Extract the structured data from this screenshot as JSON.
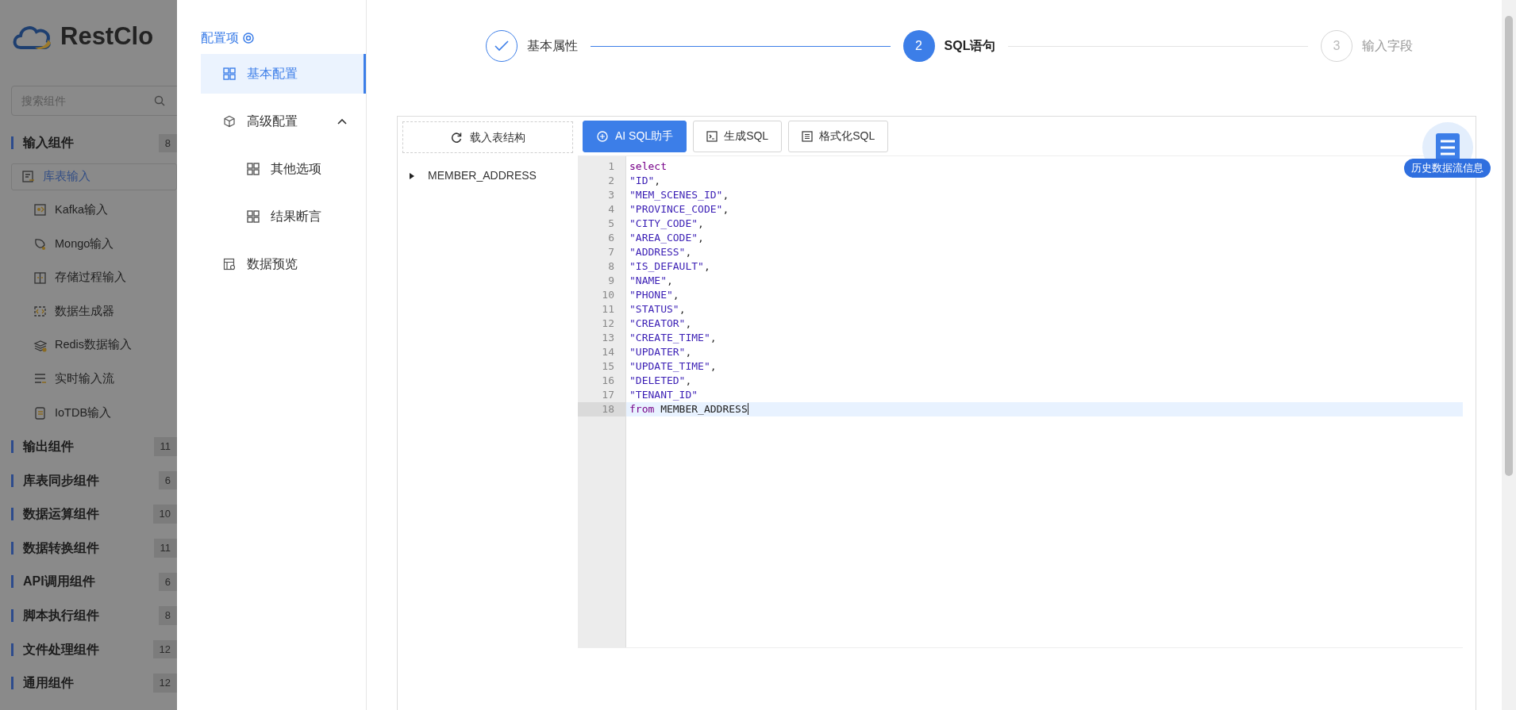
{
  "sidebar": {
    "logo_text": "RestClo",
    "search": {
      "placeholder": "搜索组件"
    },
    "groups": [
      {
        "label": "输入组件",
        "count": "8",
        "items": [
          {
            "label": "库表输入",
            "selected": true
          },
          {
            "label": "Kafka输入",
            "selected": false
          },
          {
            "label": "Mongo输入",
            "selected": false
          },
          {
            "label": "存储过程输入",
            "selected": false
          },
          {
            "label": "数据生成器",
            "selected": false
          },
          {
            "label": "Redis数据输入",
            "selected": false
          },
          {
            "label": "实时输入流",
            "selected": false
          },
          {
            "label": "IoTDB输入",
            "selected": false
          }
        ]
      },
      {
        "label": "输出组件",
        "count": "11"
      },
      {
        "label": "库表同步组件",
        "count": "6"
      },
      {
        "label": "数据运算组件",
        "count": "10"
      },
      {
        "label": "数据转换组件",
        "count": "11"
      },
      {
        "label": "API调用组件",
        "count": "6"
      },
      {
        "label": "脚本执行组件",
        "count": "8"
      },
      {
        "label": "文件处理组件",
        "count": "12"
      },
      {
        "label": "通用组件",
        "count": "12"
      }
    ]
  },
  "config_nav": {
    "title": "配置项",
    "items": [
      {
        "label": "基本配置",
        "selected": true
      },
      {
        "label": "高级配置",
        "selected": false,
        "expanded": true,
        "children": [
          {
            "label": "其他选项",
            "selected": false
          },
          {
            "label": "结果断言",
            "selected": false
          }
        ]
      },
      {
        "label": "数据预览",
        "selected": false
      }
    ]
  },
  "steps": [
    {
      "label": "基本属性",
      "done": true,
      "selected": false
    },
    {
      "number": "2",
      "label": "SQL语句",
      "done": false,
      "selected": true
    },
    {
      "number": "3",
      "label": "输入字段",
      "done": false,
      "selected": false
    }
  ],
  "table_panel": {
    "load_button": "载入表结构",
    "tables": [
      {
        "label": "MEMBER_ADDRESS",
        "expanded": false
      }
    ]
  },
  "toolbar": [
    {
      "label": "AI SQL助手",
      "kind": "primary"
    },
    {
      "label": "生成SQL",
      "kind": "terminal"
    },
    {
      "label": "格式化SQL",
      "kind": "format"
    }
  ],
  "editor": {
    "lines": [
      {
        "number": "1",
        "active": false,
        "tokens": [
          {
            "kind": "keyword",
            "text": "select"
          }
        ]
      },
      {
        "number": "2",
        "active": false,
        "tokens": [
          {
            "kind": "string",
            "text": "\"ID\""
          },
          {
            "kind": "plain",
            "text": ","
          }
        ]
      },
      {
        "number": "3",
        "active": false,
        "tokens": [
          {
            "kind": "string",
            "text": "\"MEM_SCENES_ID\""
          },
          {
            "kind": "plain",
            "text": ","
          }
        ]
      },
      {
        "number": "4",
        "active": false,
        "tokens": [
          {
            "kind": "string",
            "text": "\"PROVINCE_CODE\""
          },
          {
            "kind": "plain",
            "text": ","
          }
        ]
      },
      {
        "number": "5",
        "active": false,
        "tokens": [
          {
            "kind": "string",
            "text": "\"CITY_CODE\""
          },
          {
            "kind": "plain",
            "text": ","
          }
        ]
      },
      {
        "number": "6",
        "active": false,
        "tokens": [
          {
            "kind": "string",
            "text": "\"AREA_CODE\""
          },
          {
            "kind": "plain",
            "text": ","
          }
        ]
      },
      {
        "number": "7",
        "active": false,
        "tokens": [
          {
            "kind": "string",
            "text": "\"ADDRESS\""
          },
          {
            "kind": "plain",
            "text": ","
          }
        ]
      },
      {
        "number": "8",
        "active": false,
        "tokens": [
          {
            "kind": "string",
            "text": "\"IS_DEFAULT\""
          },
          {
            "kind": "plain",
            "text": ","
          }
        ]
      },
      {
        "number": "9",
        "active": false,
        "tokens": [
          {
            "kind": "string",
            "text": "\"NAME\""
          },
          {
            "kind": "plain",
            "text": ","
          }
        ]
      },
      {
        "number": "10",
        "active": false,
        "tokens": [
          {
            "kind": "string",
            "text": "\"PHONE\""
          },
          {
            "kind": "plain",
            "text": ","
          }
        ]
      },
      {
        "number": "11",
        "active": false,
        "tokens": [
          {
            "kind": "string",
            "text": "\"STATUS\""
          },
          {
            "kind": "plain",
            "text": ","
          }
        ]
      },
      {
        "number": "12",
        "active": false,
        "tokens": [
          {
            "kind": "string",
            "text": "\"CREATOR\""
          },
          {
            "kind": "plain",
            "text": ","
          }
        ]
      },
      {
        "number": "13",
        "active": false,
        "tokens": [
          {
            "kind": "string",
            "text": "\"CREATE_TIME\""
          },
          {
            "kind": "plain",
            "text": ","
          }
        ]
      },
      {
        "number": "14",
        "active": false,
        "tokens": [
          {
            "kind": "string",
            "text": "\"UPDATER\""
          },
          {
            "kind": "plain",
            "text": ","
          }
        ]
      },
      {
        "number": "15",
        "active": false,
        "tokens": [
          {
            "kind": "string",
            "text": "\"UPDATE_TIME\""
          },
          {
            "kind": "plain",
            "text": ","
          }
        ]
      },
      {
        "number": "16",
        "active": false,
        "tokens": [
          {
            "kind": "string",
            "text": "\"DELETED\""
          },
          {
            "kind": "plain",
            "text": ","
          }
        ]
      },
      {
        "number": "17",
        "active": false,
        "tokens": [
          {
            "kind": "string",
            "text": "\"TENANT_ID\""
          }
        ]
      },
      {
        "number": "18",
        "active": true,
        "tokens": [
          {
            "kind": "keyword",
            "text": "from"
          },
          {
            "kind": "plain",
            "text": " MEMBER_ADDRESS"
          }
        ]
      }
    ]
  },
  "history_badge": {
    "label": "历史数据流信息"
  }
}
